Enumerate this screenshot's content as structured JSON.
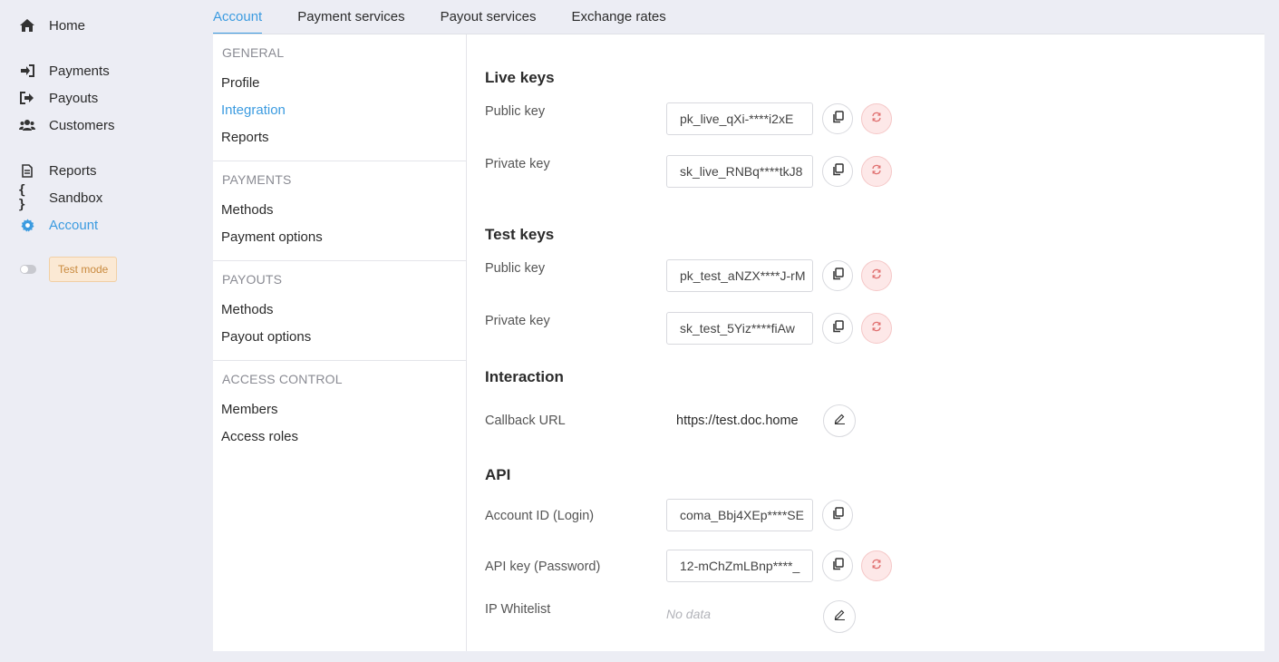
{
  "nav": {
    "items": [
      {
        "label": "Home",
        "icon": "home-icon"
      },
      {
        "label": "Payments",
        "icon": "sign-in-icon"
      },
      {
        "label": "Payouts",
        "icon": "sign-out-icon"
      },
      {
        "label": "Customers",
        "icon": "users-icon"
      },
      {
        "label": "Reports",
        "icon": "document-icon"
      },
      {
        "label": "Sandbox",
        "icon": "braces-icon"
      },
      {
        "label": "Account",
        "icon": "gear-icon"
      }
    ],
    "test_mode": "Test mode"
  },
  "tabs": [
    "Account",
    "Payment services",
    "Payout services",
    "Exchange rates"
  ],
  "subnav": {
    "general": "GENERAL",
    "profile": "Profile",
    "integration": "Integration",
    "reports": "Reports",
    "payments": "PAYMENTS",
    "payments_methods": "Methods",
    "payment_options": "Payment options",
    "payouts": "PAYOUTS",
    "payouts_methods": "Methods",
    "payout_options": "Payout options",
    "access_control": "ACCESS CONTROL",
    "members": "Members",
    "access_roles": "Access roles"
  },
  "live": {
    "title": "Live keys",
    "public_label": "Public key",
    "public_value": "pk_live_qXi-****i2xE",
    "private_label": "Private key",
    "private_value": "sk_live_RNBq****tkJ8"
  },
  "test": {
    "title": "Test keys",
    "public_label": "Public key",
    "public_value": "pk_test_aNZX****J-rM",
    "private_label": "Private key",
    "private_value": "sk_test_5Yiz****fiAw"
  },
  "interaction": {
    "title": "Interaction",
    "callback_label": "Callback URL",
    "callback_value": "https://test.doc.home"
  },
  "api": {
    "title": "API",
    "account_id_label": "Account ID (Login)",
    "account_id_value": "coma_Bbj4XEp****SE",
    "api_key_label": "API key (Password)",
    "api_key_value": "12-mChZmLBnp****_",
    "whitelist_label": "IP Whitelist",
    "whitelist_value": "No data"
  },
  "colors": {
    "accent": "#3b9be0",
    "danger_bg": "#fde8e8",
    "danger_icon": "#e07070"
  }
}
